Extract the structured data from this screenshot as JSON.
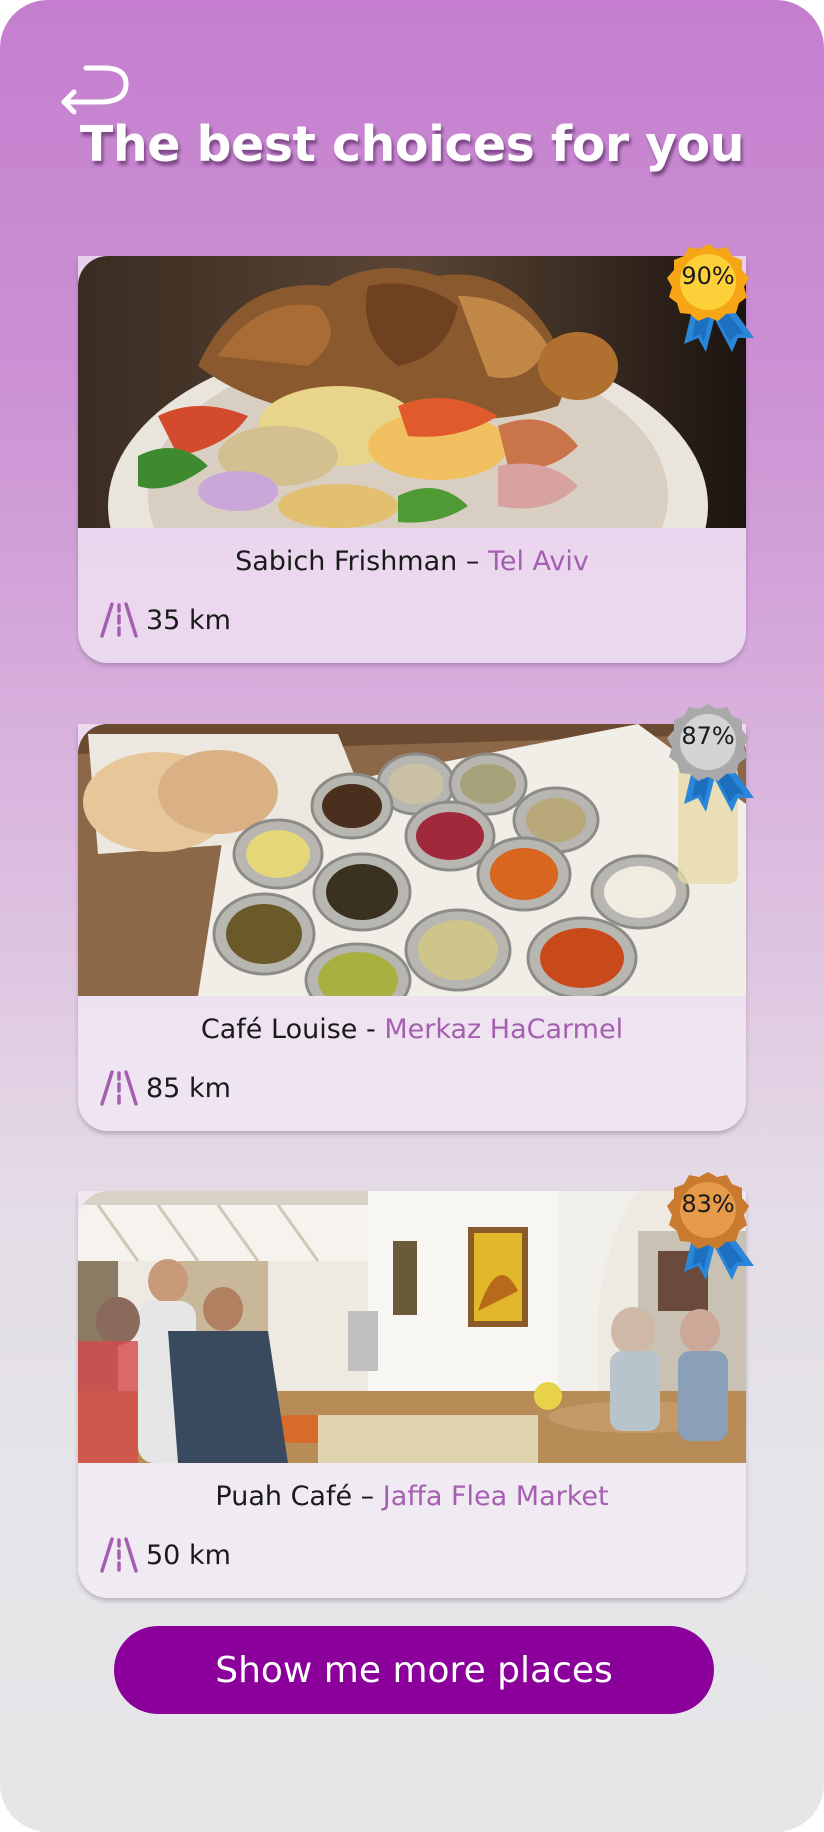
{
  "header": {
    "title": "The best choices for you",
    "back_icon": "return-arrow-icon"
  },
  "cards": [
    {
      "name": "Sabich Frishman",
      "separator": " – ",
      "location": "Tel Aviv",
      "distance": "35 km",
      "match": "90%",
      "badge_color": "#f6a615",
      "photo": "sabich-plate-photo"
    },
    {
      "name": "Café Louise",
      "separator": " - ",
      "location": "Merkaz HaCarmel",
      "distance": "85 km",
      "match": "87%",
      "badge_color": "#b9b9b9",
      "photo": "mezze-salads-photo"
    },
    {
      "name": "Puah Café",
      "separator": " – ",
      "location": "Jaffa Flea Market",
      "distance": "50 km",
      "match": "83%",
      "badge_color": "#d98a38",
      "photo": "cafe-interior-photo"
    }
  ],
  "footer": {
    "more_label": "Show me more places"
  },
  "colors": {
    "accent": "#8b009b",
    "location_text": "#a55fb0",
    "ribbon": "#2a86d8"
  }
}
